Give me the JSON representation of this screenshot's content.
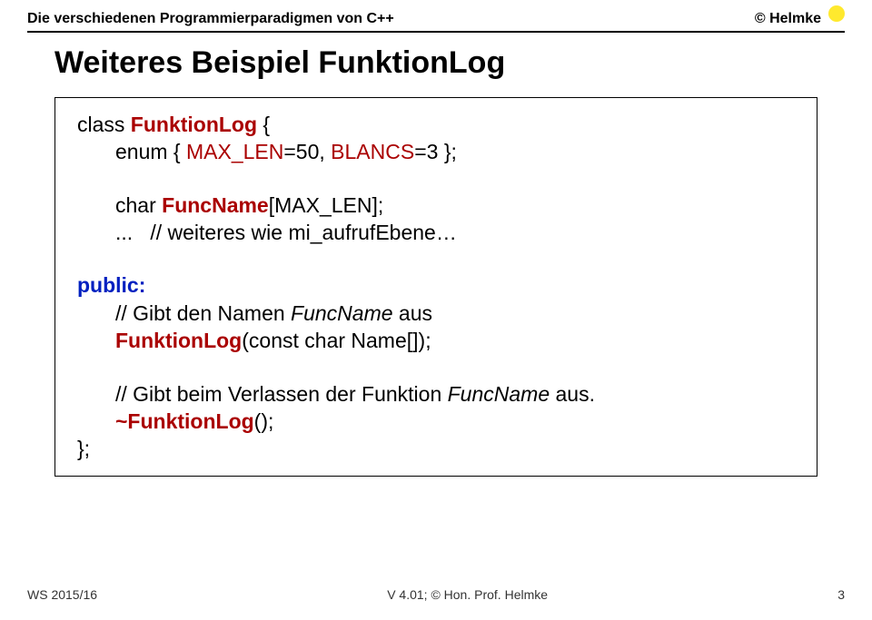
{
  "header": {
    "left": "Die verschiedenen Programmierparadigmen von C++",
    "right": "© Helmke"
  },
  "title": "Weiteres Beispiel FunktionLog",
  "code": {
    "line1_pre": "class ",
    "line1_ident": "FunktionLog",
    "line1_post": " {",
    "line2_pre": "enum { ",
    "line2_a": "MAX_LEN",
    "line2_mid1": "=50, ",
    "line2_b": "BLANCS",
    "line2_post": "=3 };",
    "line3_pre": "char ",
    "line3_ident": "FuncName",
    "line3_post": "[MAX_LEN];",
    "line4": "...   // weiteres wie mi_aufrufEbene…",
    "line5_kw": "public:",
    "line6_pre": "// Gibt den Namen ",
    "line6_it": "FuncName",
    "line6_post": " aus",
    "line7_ident": "FunktionLog",
    "line7_post": "(const char Name[]);",
    "line8_pre": "// Gibt beim Verlassen der Funktion ",
    "line8_it": "FuncName",
    "line8_post": " aus.",
    "line9_ident": "~FunktionLog",
    "line9_post": "();",
    "line10": "};"
  },
  "footer": {
    "left": "WS 2015/16",
    "center": "V 4.01; © Hon. Prof. Helmke",
    "right": "3"
  }
}
